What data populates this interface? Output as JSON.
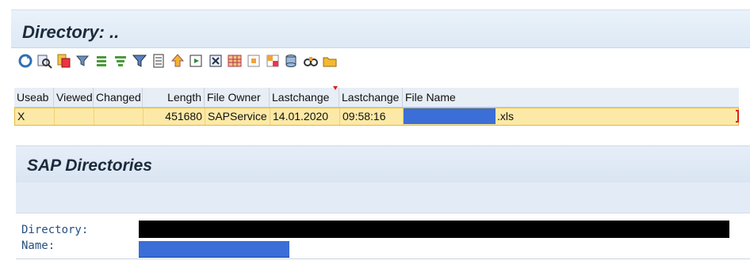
{
  "directory_window": {
    "title": "Directory: ..",
    "toolbar": [
      "refresh-icon",
      "find-icon",
      "copy-icon",
      "filter-icon",
      "align-icon",
      "sort-icon",
      "funnel-icon",
      "export-icon",
      "sort-up-icon",
      "next-icon",
      "print-icon",
      "grid-icon",
      "layout-icon",
      "layout2-icon",
      "database-icon",
      "binoculars-icon",
      "folder-icon"
    ],
    "columns": [
      "Useab",
      "Viewed",
      "Changed",
      "Length",
      "File Owner",
      "Lastchange",
      "Lastchange",
      "File Name"
    ],
    "rows": [
      {
        "useable": "X",
        "viewed": "",
        "changed": "",
        "length": "451680",
        "file_owner": "SAPService",
        "lastchange_date": "14.01.2020",
        "lastchange_time": "09:58:16",
        "file_name_suffix": ".xls"
      }
    ]
  },
  "sap_directories_window": {
    "title": "SAP Directories",
    "fields": {
      "directory_label": "Directory:",
      "name_label": "Name:"
    }
  },
  "colors": {
    "row_highlight": "#fde9a7",
    "title_bar": "#e1ebf6",
    "redaction_blue": "#3b6ed6",
    "redaction_black": "#000000",
    "label_blue": "#25507f"
  }
}
